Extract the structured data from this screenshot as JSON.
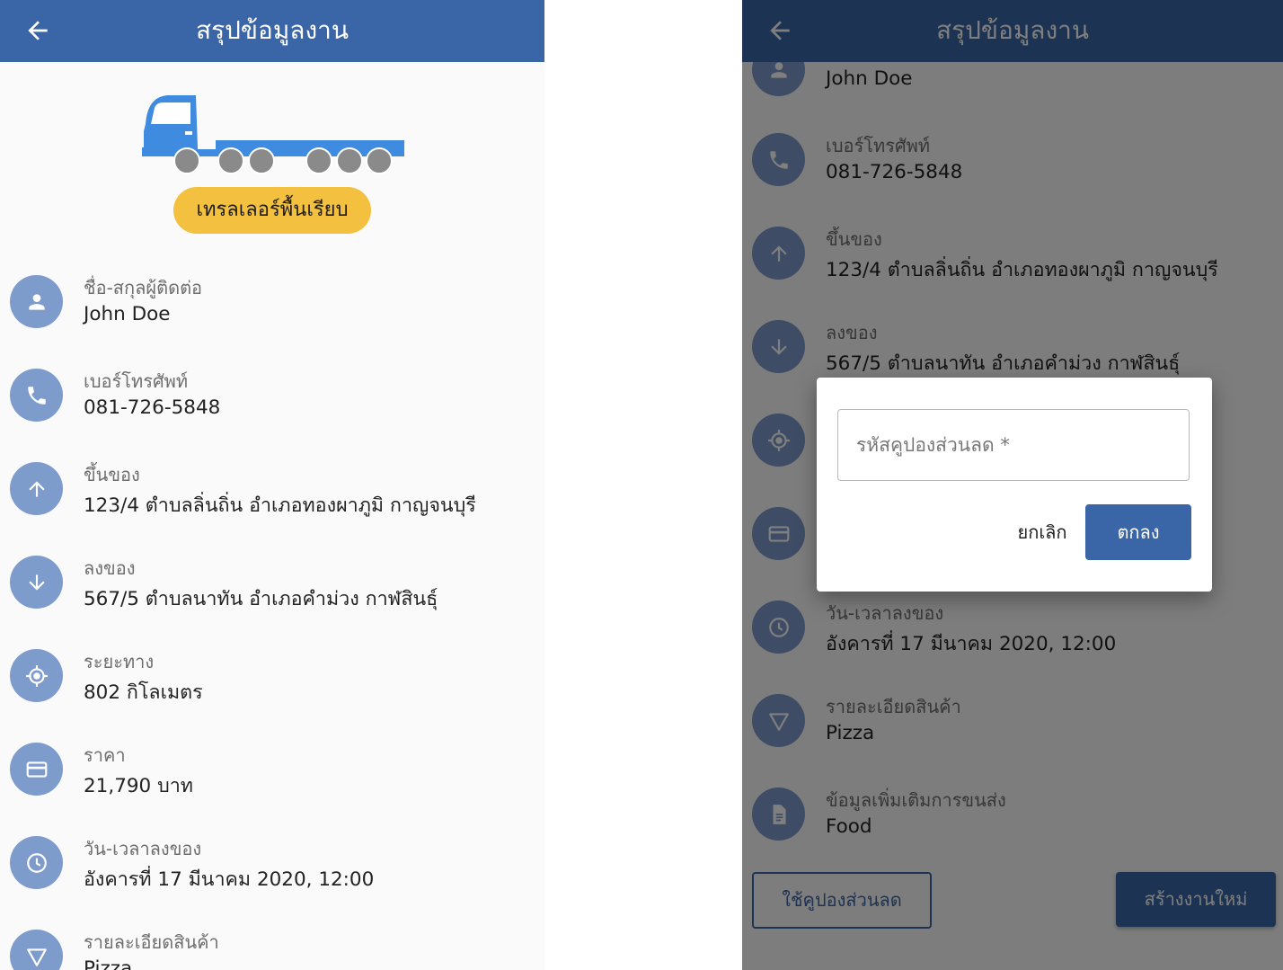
{
  "app": {
    "title": "สรุปข้อมูลงาน",
    "brand_color": "#3a66a8",
    "accent_color": "#f3c03f"
  },
  "left": {
    "vehicle_type": "เทรลเลอร์พื้นเรียบ",
    "vehicle_icon": "flatbed-trailer-truck-icon",
    "details": [
      {
        "icon": "person-icon",
        "label": "ชื่อ-สกุลผู้ติดต่อ",
        "value": "John Doe"
      },
      {
        "icon": "phone-icon",
        "label": "เบอร์โทรศัพท์",
        "value": "081-726-5848"
      },
      {
        "icon": "arrow-up-icon",
        "label": "ขึ้นของ",
        "value": "123/4 ตำบลลิ่นถิ่น อำเภอทองผาภูมิ กาญจนบุรี"
      },
      {
        "icon": "arrow-down-icon",
        "label": "ลงของ",
        "value": "567/5 ตำบลนาทัน อำเภอคำม่วง กาฬสินธุ์"
      },
      {
        "icon": "location-target-icon",
        "label": "ระยะทาง",
        "value": "802 กิโลเมตร"
      },
      {
        "icon": "credit-card-icon",
        "label": "ราคา",
        "value": "21,790 บาท"
      },
      {
        "icon": "clock-icon",
        "label": "วัน-เวลาลงของ",
        "value": "อังคารที่ 17 มีนาคม 2020, 12:00"
      },
      {
        "icon": "triangle-down-icon",
        "label": "รายละเอียดสินค้า",
        "value": "Pizza"
      }
    ]
  },
  "right": {
    "details": [
      {
        "icon": "person-icon",
        "label": "",
        "value": "John Doe"
      },
      {
        "icon": "phone-icon",
        "label": "เบอร์โทรศัพท์",
        "value": "081-726-5848"
      },
      {
        "icon": "arrow-up-icon",
        "label": "ขึ้นของ",
        "value": "123/4 ตำบลลิ่นถิ่น อำเภอทองผาภูมิ กาญจนบุรี"
      },
      {
        "icon": "arrow-down-icon",
        "label": "ลงของ",
        "value": "567/5 ตำบลนาทัน อำเภอคำม่วง กาฬสินธุ์"
      },
      {
        "icon": "location-target-icon",
        "label": "",
        "value": ""
      },
      {
        "icon": "credit-card-icon",
        "label": "",
        "value": ""
      },
      {
        "icon": "clock-icon",
        "label": "วัน-เวลาลงของ",
        "value": "อังคารที่ 17 มีนาคม 2020, 12:00"
      },
      {
        "icon": "triangle-down-icon",
        "label": "รายละเอียดสินค้า",
        "value": "Pizza"
      },
      {
        "icon": "document-icon",
        "label": "ข้อมูลเพิ่มเติมการขนส่ง",
        "value": "Food"
      }
    ],
    "use_coupon_label": "ใช้คูปองส่วนลด",
    "create_job_label": "สร้างงานใหม่",
    "dialog": {
      "coupon_placeholder": "รหัสคูปองส่วนลด *",
      "cancel_label": "ยกเลิก",
      "ok_label": "ตกลง"
    }
  }
}
